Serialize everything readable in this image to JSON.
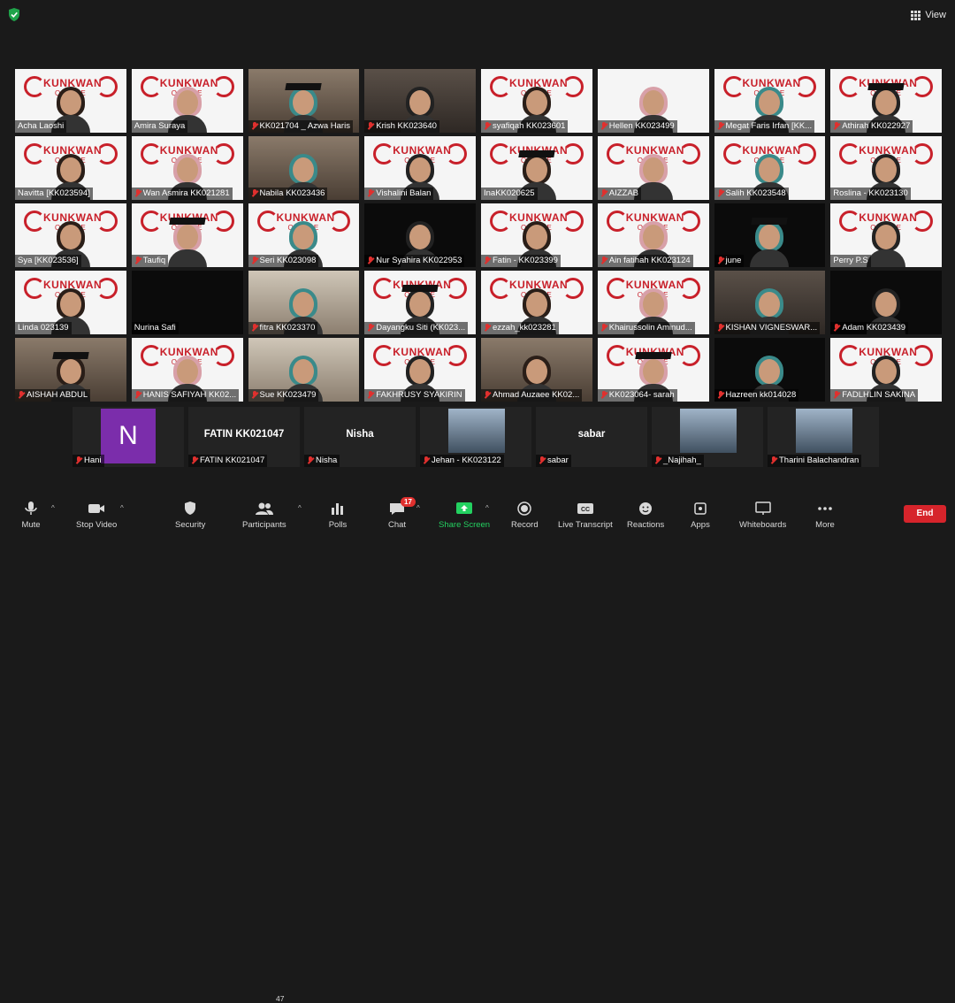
{
  "top": {
    "view_label": "View"
  },
  "tiles": [
    {
      "name": "Acha Laoshi",
      "muted": false,
      "bg": "logo",
      "speaking": false
    },
    {
      "name": "Amira Suraya",
      "muted": false,
      "bg": "logo",
      "speaking": true
    },
    {
      "name": "KK021704 _ Azwa Haris",
      "muted": true,
      "bg": "room",
      "speaking": false
    },
    {
      "name": "Krish KK023640",
      "muted": true,
      "bg": "mid",
      "speaking": false
    },
    {
      "name": "syafiqah KK023601",
      "muted": true,
      "bg": "logo",
      "speaking": false
    },
    {
      "name": "Hellen KK023499",
      "muted": true,
      "bg": "white",
      "speaking": false
    },
    {
      "name": "Megat Faris Irfan [KK...",
      "muted": true,
      "bg": "logo",
      "speaking": false
    },
    {
      "name": "Athirah KK022927",
      "muted": true,
      "bg": "logo",
      "speaking": false
    },
    {
      "name": "Navitta [KK023594]",
      "muted": false,
      "bg": "logo",
      "speaking": false
    },
    {
      "name": "Wan Asmira KK021281",
      "muted": true,
      "bg": "logo",
      "speaking": false
    },
    {
      "name": "Nabila KK023436",
      "muted": true,
      "bg": "room",
      "speaking": false
    },
    {
      "name": "Vishalini Balan",
      "muted": true,
      "bg": "logo",
      "speaking": false
    },
    {
      "name": "InaKK020625",
      "muted": false,
      "bg": "logo",
      "speaking": false
    },
    {
      "name": "AIZZAB",
      "muted": true,
      "bg": "logo",
      "speaking": false
    },
    {
      "name": "Salih KK023548",
      "muted": true,
      "bg": "logo",
      "speaking": false
    },
    {
      "name": "Roslina - KK023130",
      "muted": false,
      "bg": "logo",
      "speaking": false
    },
    {
      "name": "Sya [KK023536]",
      "muted": false,
      "bg": "logo",
      "speaking": false
    },
    {
      "name": "Taufiq",
      "muted": true,
      "bg": "logo",
      "speaking": false
    },
    {
      "name": "Seri KK023098",
      "muted": true,
      "bg": "logo",
      "speaking": false
    },
    {
      "name": "Nur Syahira KK022953",
      "muted": true,
      "bg": "dark",
      "speaking": false
    },
    {
      "name": "Fatin - KK023399",
      "muted": true,
      "bg": "logo",
      "speaking": false
    },
    {
      "name": "Ain fatihah KK023124",
      "muted": true,
      "bg": "logo",
      "speaking": false
    },
    {
      "name": "june",
      "muted": true,
      "bg": "dark",
      "speaking": false
    },
    {
      "name": "Perry P.S",
      "muted": false,
      "bg": "logo",
      "speaking": false
    },
    {
      "name": "Linda 023139",
      "muted": false,
      "bg": "logo",
      "speaking": false
    },
    {
      "name": "Nurina Safi",
      "muted": false,
      "bg": "dark",
      "speaking": false
    },
    {
      "name": "fitra KK023370",
      "muted": true,
      "bg": "window",
      "speaking": false
    },
    {
      "name": "Dayangku Siti (KK023...",
      "muted": true,
      "bg": "logo",
      "speaking": false
    },
    {
      "name": "ezzah_kk023281",
      "muted": true,
      "bg": "logo",
      "speaking": false
    },
    {
      "name": "Khairussolin Aminud...",
      "muted": true,
      "bg": "logo",
      "speaking": false
    },
    {
      "name": "KISHAN VIGNESWAR...",
      "muted": true,
      "bg": "mid",
      "speaking": false
    },
    {
      "name": "Adam KK023439",
      "muted": true,
      "bg": "dark",
      "speaking": false
    },
    {
      "name": "AISHAH ABDUL",
      "muted": true,
      "bg": "room",
      "speaking": false
    },
    {
      "name": "HANIS SAFIYAH KK02...",
      "muted": true,
      "bg": "logo",
      "speaking": false
    },
    {
      "name": "Sue KK023479",
      "muted": true,
      "bg": "window",
      "speaking": false
    },
    {
      "name": "FAKHRUSY SYAKIRIN",
      "muted": true,
      "bg": "logo",
      "speaking": false
    },
    {
      "name": "Ahmad Auzaee KK02...",
      "muted": true,
      "bg": "room",
      "speaking": false
    },
    {
      "name": "KK023064- sarah",
      "muted": true,
      "bg": "logo",
      "speaking": false
    },
    {
      "name": "Hazreen kk014028",
      "muted": true,
      "bg": "dark",
      "speaking": false
    },
    {
      "name": "FADLHLIN SAKINA",
      "muted": true,
      "bg": "logo",
      "speaking": false
    }
  ],
  "logo": {
    "brand": "KUNKWAN",
    "sub": "ONLINE CLASS"
  },
  "bottom_tiles": [
    {
      "type": "avatar",
      "initial": "N",
      "name": "Hani"
    },
    {
      "type": "text",
      "big": "FATIN KK021047",
      "name": "FATIN KK021047"
    },
    {
      "type": "text",
      "big": "Nisha",
      "name": "Nisha"
    },
    {
      "type": "photo",
      "name": "Jehan - KK023122"
    },
    {
      "type": "text",
      "big": "sabar",
      "name": "sabar"
    },
    {
      "type": "photo",
      "name": "_Najihah_"
    },
    {
      "type": "photo",
      "name": "Tharini Balachandran"
    }
  ],
  "toolbar": {
    "mute": "Mute",
    "stop_video": "Stop Video",
    "security": "Security",
    "participants": "Participants",
    "participants_count": "47",
    "polls": "Polls",
    "chat": "Chat",
    "chat_badge": "17",
    "share_screen": "Share Screen",
    "record": "Record",
    "live_transcript": "Live Transcript",
    "reactions": "Reactions",
    "apps": "Apps",
    "whiteboards": "Whiteboards",
    "more": "More",
    "end": "End"
  },
  "colors": {
    "accent_green": "#23d160",
    "end_red": "#d6242b",
    "speaking_outline": "#b7d84d"
  }
}
